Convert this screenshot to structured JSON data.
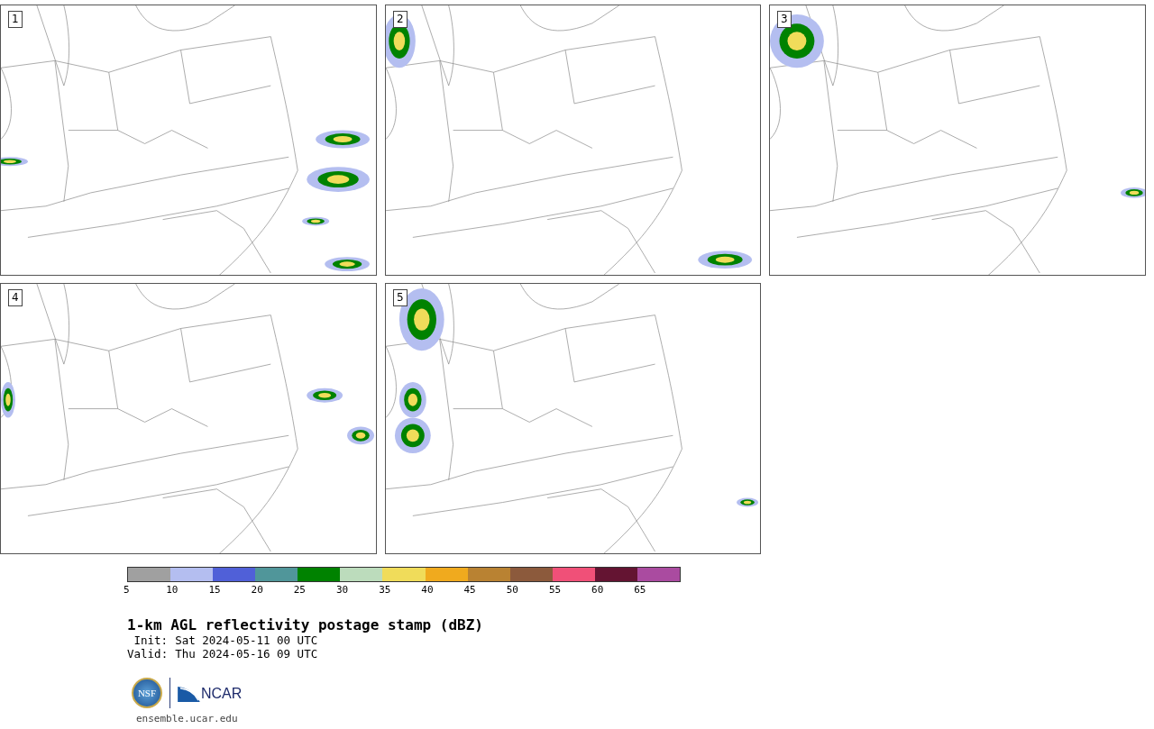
{
  "panels": [
    {
      "number": "1"
    },
    {
      "number": "2"
    },
    {
      "number": "3"
    },
    {
      "number": "4"
    },
    {
      "number": "5"
    }
  ],
  "colorbar": {
    "segments": [
      {
        "color": "#a0a0a0"
      },
      {
        "color": "#b4bef0"
      },
      {
        "color": "#5060d8"
      },
      {
        "color": "#50969a"
      },
      {
        "color": "#008200"
      },
      {
        "color": "#bcdcbc"
      },
      {
        "color": "#f0dc5a"
      },
      {
        "color": "#f0aa1e"
      },
      {
        "color": "#b98232"
      },
      {
        "color": "#8c5a3c"
      },
      {
        "color": "#f05078"
      },
      {
        "color": "#641432"
      },
      {
        "color": "#aa4ba0"
      }
    ],
    "ticks": [
      "5",
      "10",
      "15",
      "20",
      "25",
      "30",
      "35",
      "40",
      "45",
      "50",
      "55",
      "60",
      "65"
    ]
  },
  "title": "1-km AGL reflectivity postage stamp (dBZ)",
  "times": [
    {
      "label": "Init:",
      "value": "Sat 2024-05-11 00 UTC"
    },
    {
      "label": "Valid:",
      "value": "Thu 2024-05-16 09 UTC"
    }
  ],
  "logos": {
    "left": "NSF",
    "right": "NCAR"
  },
  "footer": "ensemble.ucar.edu"
}
